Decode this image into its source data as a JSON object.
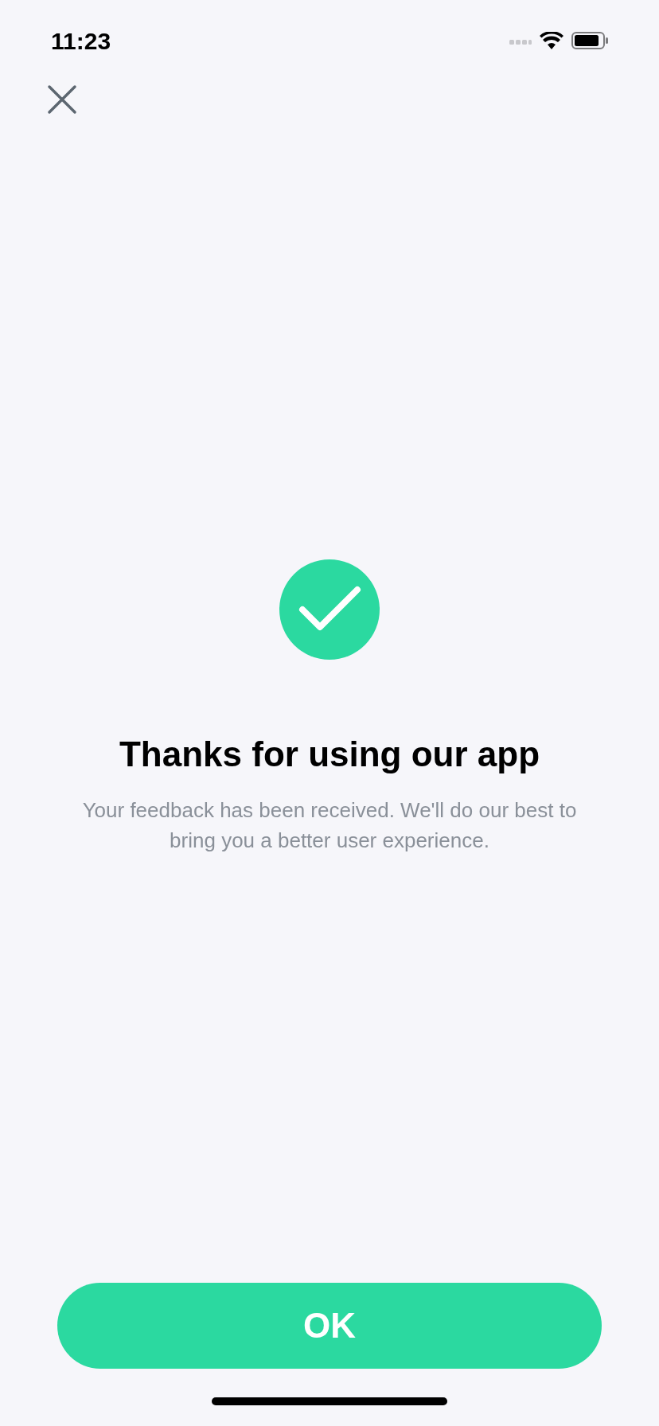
{
  "status_bar": {
    "time": "11:23"
  },
  "title": "Thanks for using our app",
  "message": "Your feedback has been received. We'll do our best to bring you a better user experience.",
  "ok_button": {
    "label": "OK"
  }
}
